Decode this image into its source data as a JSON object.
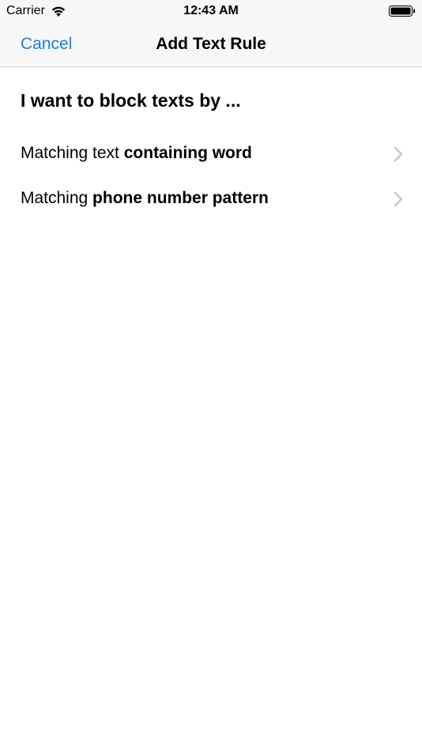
{
  "status_bar": {
    "carrier": "Carrier",
    "time": "12:43 AM",
    "icons": [
      "wifi-icon",
      "battery-icon"
    ]
  },
  "nav": {
    "cancel_label": "Cancel",
    "title": "Add Text Rule"
  },
  "section": {
    "header": "I want to block texts by ..."
  },
  "options": [
    {
      "prefix": "Matching text ",
      "emphasis": "containing word",
      "icon": "chevron-right-icon"
    },
    {
      "prefix": "Matching ",
      "emphasis": "phone number pattern",
      "icon": "chevron-right-icon"
    }
  ],
  "colors": {
    "accent": "#1a7fe6",
    "bar_background": "#f7f7f7",
    "separator": "#d0d0d3",
    "chevron": "#c7c7cc"
  }
}
